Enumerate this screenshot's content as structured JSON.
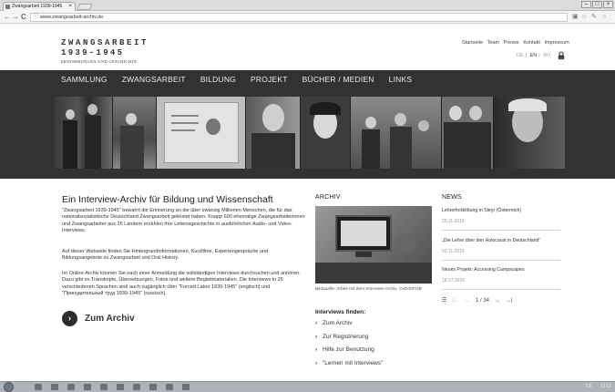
{
  "browser": {
    "tab_title": "Zwangsarbeit 1939-1945",
    "tab_close": "×",
    "url": "www.zwangsarbeit-archiv.de",
    "back": "←",
    "forward": "→",
    "reload": "C"
  },
  "header": {
    "logo_line1": "ZWANGSARBEIT",
    "logo_line2": "1939-1945",
    "logo_line3": "ERINNERUNGEN UND GESCHICHTE",
    "top_links": [
      "Startseite",
      "Team",
      "Presse",
      "Kontakt",
      "Impressum"
    ],
    "languages": [
      "DE",
      "EN",
      "RU"
    ],
    "active_language": "EN"
  },
  "nav": {
    "items": [
      "SAMMLUNG",
      "ZWANGSARBEIT",
      "BILDUNG",
      "PROJEKT",
      "BÜCHER / MEDIEN",
      "LINKS"
    ]
  },
  "main": {
    "heading": "Ein Interview-Archiv für Bildung und Wissenschaft",
    "paragraphs": [
      "\"Zwangsarbeit 1939-1945\" bewahrt die Erinnerung an die über zwanzig Millionen Menschen, die für das nationalsozialistische Deutschland Zwangsarbeit geleistet haben. Knapp 600 ehemalige Zwangsarbeiterinnen und Zwangsarbeiter aus 26 Ländern erzählen ihre Lebensgeschichte in ausführlichen Audio- und Video-Interviews.",
      "Auf dieser Webseite finden Sie Hintergrundinformationen, Kurzfilme, Expertengespräche und Bildungsangebote zu Zwangsarbeit und Oral History.",
      "Im Online-Archiv können Sie nach einer Anmeldung die vollständigen Interviews durchsuchen und anhören. Dazu gibt es Transkripte, Übersetzungen, Fotos und weitere Begleitmaterialien. Die Interviews in 25 verschiedenen Sprachen sind auch zugänglich über \"Forced Labor 1939-1945\" (englisch) und \"Принудительный труд 1939-1945\" (russisch)."
    ],
    "cta_icon": "›",
    "cta_label": "Zum Archiv"
  },
  "archive": {
    "heading": "ARCHIV",
    "caption": "Bildquelle: Arbeit mit dem Interview-Archiv, CeDiS/FUB",
    "interviews_heading": "Interviews finden:",
    "chevron": "›",
    "links": [
      "Zum Archiv",
      "Zur Registrierung",
      "Hilfe zur Benutzung",
      "\"Lernen mit Interviews\""
    ]
  },
  "news": {
    "heading": "NEWS",
    "items": [
      {
        "title": "Lehrerfortbildung in Steyr (Österreich)",
        "date": "25.11.2016"
      },
      {
        "title": "„Die Lehre über den Holocaust in Deutschland“",
        "date": "03.11.2016"
      },
      {
        "title": "Neues Projekt: Accessing Campscapes",
        "date": "18.07.2016"
      }
    ],
    "pager": {
      "current": "1",
      "total": "34",
      "separator": "/"
    }
  },
  "taskbar": {
    "tray_text": "DE",
    "clock": "13:12"
  }
}
